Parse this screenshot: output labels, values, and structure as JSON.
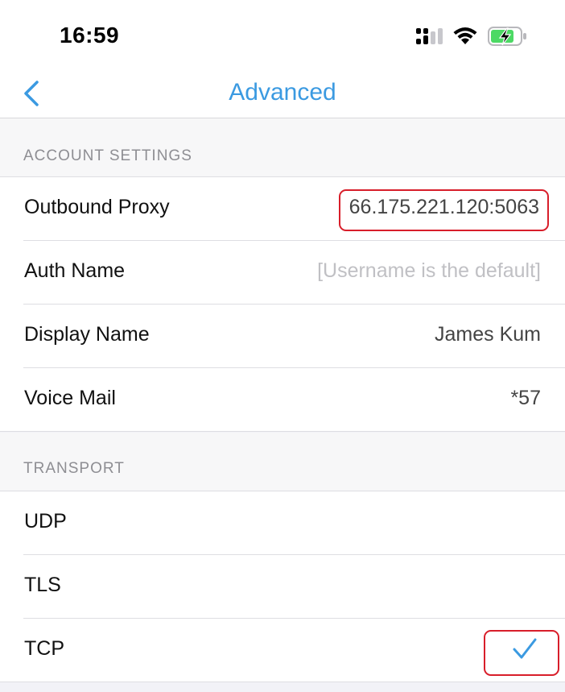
{
  "status_bar": {
    "time": "16:59",
    "signal_icon": "cellular-signal-icon",
    "wifi_icon": "wifi-icon",
    "battery_icon": "battery-charging-icon",
    "battery_color": "#4cd964"
  },
  "nav": {
    "back_icon": "chevron-left-icon",
    "title": "Advanced",
    "accent_color": "#3b9ae1"
  },
  "account_settings": {
    "header": "ACCOUNT SETTINGS",
    "rows": [
      {
        "label": "Outbound Proxy",
        "value": "66.175.221.120:5063",
        "highlighted": true
      },
      {
        "label": "Auth Name",
        "placeholder": "[Username is the default]"
      },
      {
        "label": "Display Name",
        "value": "James Kum"
      },
      {
        "label": "Voice Mail",
        "value": "*57"
      }
    ]
  },
  "transport": {
    "header": "TRANSPORT",
    "options": [
      {
        "label": "UDP",
        "selected": false
      },
      {
        "label": "TLS",
        "selected": false
      },
      {
        "label": "TCP",
        "selected": true
      }
    ],
    "selected_icon": "checkmark-icon"
  },
  "highlight_color": "#d81e2a"
}
